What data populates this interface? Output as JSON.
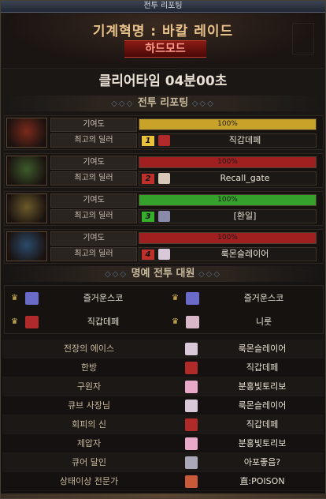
{
  "window": {
    "title": "전투 리포팅"
  },
  "header": {
    "raid_title": "기계혁명 : 바칼 레이드",
    "mode": "하드모드",
    "clear_time": "클리어타임  04분00초"
  },
  "report_section": {
    "title": "전투 리포팅"
  },
  "labels": {
    "contribution": "기여도",
    "best_dealer": "최고의 딜러"
  },
  "parties": [
    {
      "contribution_text": "100%",
      "contribution_value": 100,
      "bar_color": "#c9a22a",
      "rank": "1",
      "rank_color": "#e8c23a",
      "dealer": "직갑데페",
      "avatar_color": "#7a2a1a",
      "mini_color": "#b02a2a"
    },
    {
      "contribution_text": "100%",
      "contribution_value": 100,
      "bar_color": "#a01f1f",
      "rank": "2",
      "rank_color": "#c0302a",
      "dealer": "Recall_gate",
      "avatar_color": "#3d5a2a",
      "mini_color": "#d8c8b8"
    },
    {
      "contribution_text": "100%",
      "contribution_value": 100,
      "bar_color": "#35a02a",
      "rank": "3",
      "rank_color": "#35b02a",
      "dealer": "[환일]",
      "avatar_color": "#6a5a2a",
      "mini_color": "#8a8aaa"
    },
    {
      "contribution_text": "100%",
      "contribution_value": 100,
      "bar_color": "#a01f1f",
      "rank": "4",
      "rank_color": "#c0302a",
      "dealer": "룩몬슬레이어",
      "avatar_color": "#2a4a6a",
      "mini_color": "#d8c8d8"
    }
  ],
  "honor_section": {
    "title": "명예 전투 대원",
    "members": [
      {
        "name": "즐거운스코",
        "mini_color": "#6a6ac8"
      },
      {
        "name": "즐거운스코",
        "mini_color": "#6a6ac8"
      },
      {
        "name": "직갑데페",
        "mini_color": "#b02a2a"
      },
      {
        "name": "니룻",
        "mini_color": "#d8b8c8"
      }
    ]
  },
  "awards": [
    {
      "title": "전장의 에이스",
      "player": "룩몬슬레이어",
      "mini_color": "#d8c8d8"
    },
    {
      "title": "한방",
      "player": "직갑데페",
      "mini_color": "#b02a2a"
    },
    {
      "title": "구원자",
      "player": "분홍빛토리보",
      "mini_color": "#e8a8c8"
    },
    {
      "title": "큐브 사장님",
      "player": "룩몬슬레이어",
      "mini_color": "#d8c8d8"
    },
    {
      "title": "회피의 신",
      "player": "직갑데페",
      "mini_color": "#b02a2a"
    },
    {
      "title": "제압자",
      "player": "분홍빛토리보",
      "mini_color": "#e8a8c8"
    },
    {
      "title": "큐어 달인",
      "player": "아포좋음?",
      "mini_color": "#a8a8b8"
    },
    {
      "title": "상태이상 전문가",
      "player": "直:POISON",
      "mini_color": "#c85a3a"
    }
  ]
}
